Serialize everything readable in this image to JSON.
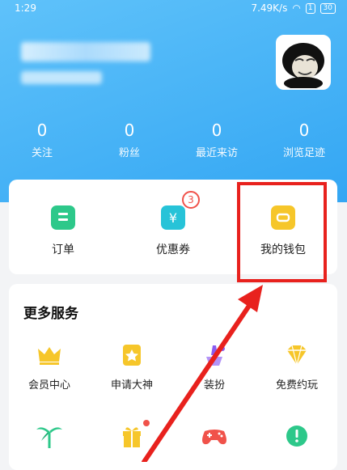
{
  "status_bar": {
    "time": "1:29",
    "speed": "7.49K/s",
    "sim": "1",
    "battery": "30"
  },
  "stats": [
    {
      "value": "0",
      "label": "关注"
    },
    {
      "value": "0",
      "label": "粉丝"
    },
    {
      "value": "0",
      "label": "最近来访"
    },
    {
      "value": "0",
      "label": "浏览足迹"
    }
  ],
  "quick_actions": [
    {
      "label": "订单",
      "icon": "order-icon",
      "color": "#2dc88a"
    },
    {
      "label": "优惠券",
      "icon": "coupon-icon",
      "color": "#27c3d8",
      "badge": "3"
    },
    {
      "label": "我的钱包",
      "icon": "wallet-icon",
      "color": "#f6c62a"
    }
  ],
  "more_services": {
    "title": "更多服务",
    "items": [
      {
        "label": "会员中心",
        "icon": "crown-icon"
      },
      {
        "label": "申请大神",
        "icon": "star-badge-icon"
      },
      {
        "label": "装扮",
        "icon": "brush-icon"
      },
      {
        "label": "免费约玩",
        "icon": "diamond-icon"
      },
      {
        "label": "",
        "icon": "palm-tree-icon"
      },
      {
        "label": "",
        "icon": "gift-icon"
      },
      {
        "label": "",
        "icon": "gamepad-icon"
      },
      {
        "label": "",
        "icon": "alert-icon"
      }
    ]
  },
  "colors": {
    "header": "#3fb0f5",
    "highlight": "#e8211d",
    "accent_gold": "#f6c62a"
  }
}
